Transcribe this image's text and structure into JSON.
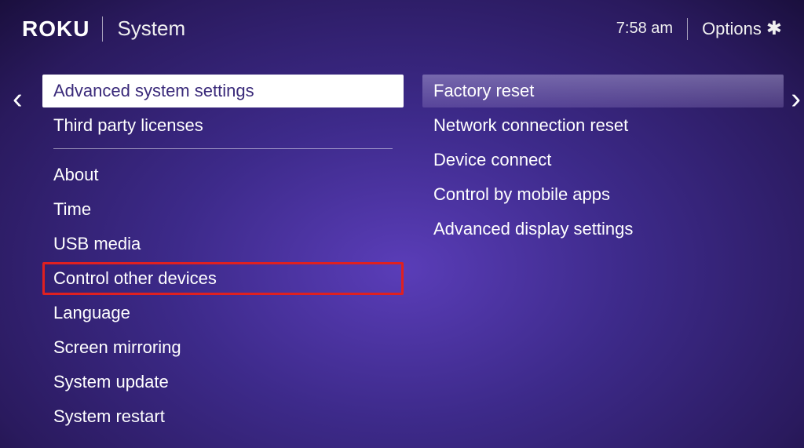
{
  "header": {
    "logo": "ROKU",
    "title": "System",
    "time": "7:58  am",
    "options_label": "Options",
    "options_glyph": "✱"
  },
  "left_menu": {
    "top": [
      {
        "label": "Advanced system settings",
        "selected": true
      },
      {
        "label": "Third party licenses",
        "selected": false
      }
    ],
    "bottom": [
      {
        "label": "About",
        "highlighted": false
      },
      {
        "label": "Time",
        "highlighted": false
      },
      {
        "label": "USB media",
        "highlighted": false
      },
      {
        "label": "Control other devices",
        "highlighted": true
      },
      {
        "label": "Language",
        "highlighted": false
      },
      {
        "label": "Screen mirroring",
        "highlighted": false
      },
      {
        "label": "System update",
        "highlighted": false
      },
      {
        "label": "System restart",
        "highlighted": false
      }
    ]
  },
  "right_menu": [
    {
      "label": "Factory reset",
      "selected": true
    },
    {
      "label": "Network connection reset",
      "selected": false
    },
    {
      "label": "Device connect",
      "selected": false
    },
    {
      "label": "Control by mobile apps",
      "selected": false
    },
    {
      "label": "Advanced display settings",
      "selected": false
    }
  ],
  "nav": {
    "left_arrow": "‹",
    "right_arrow": "›"
  }
}
